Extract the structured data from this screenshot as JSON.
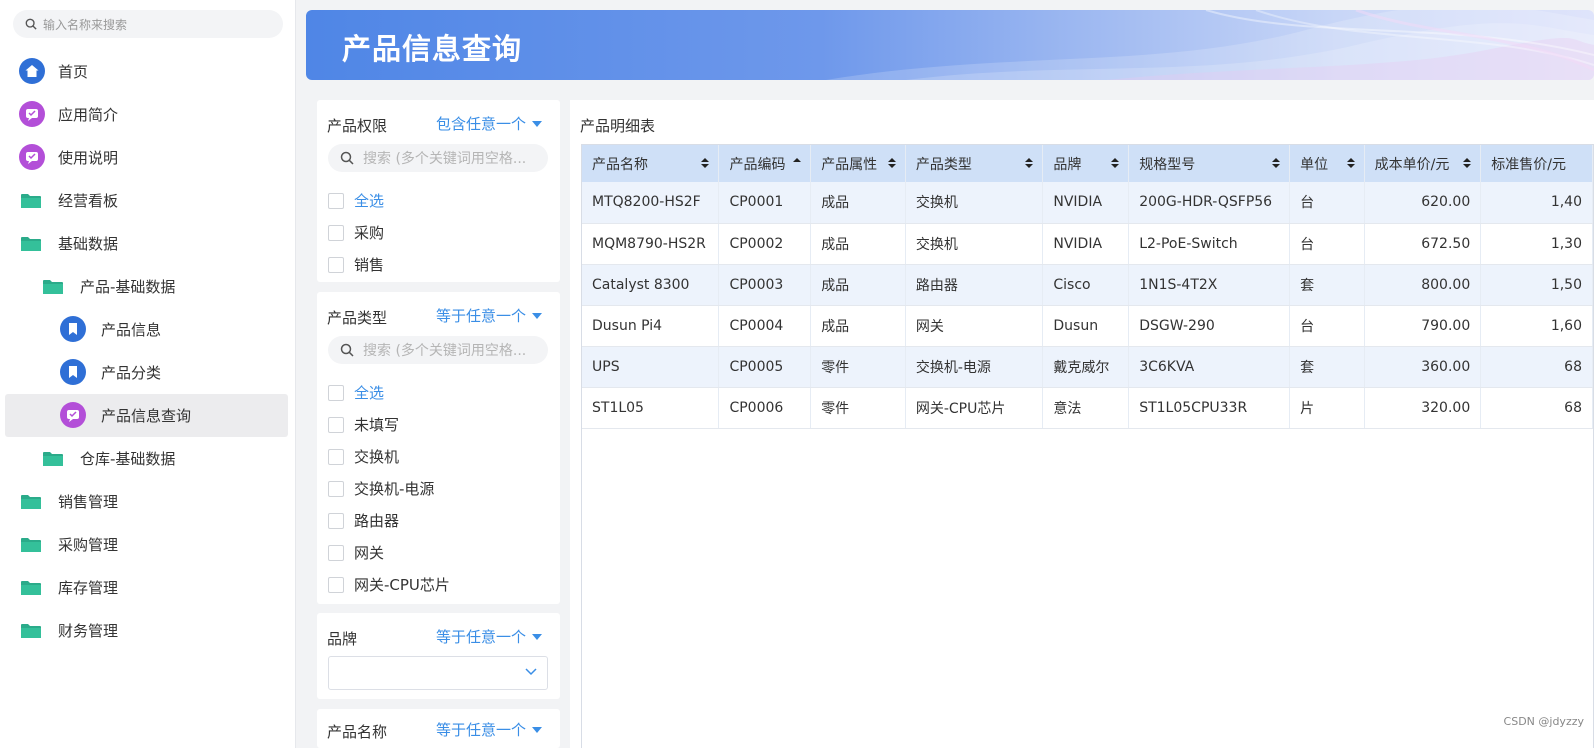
{
  "sidebar": {
    "search_placeholder": "输入名称来搜索",
    "items": [
      {
        "label": "首页",
        "icon": "home-icon"
      },
      {
        "label": "应用简介",
        "icon": "app-icon"
      },
      {
        "label": "使用说明",
        "icon": "app-icon"
      },
      {
        "label": "经营看板",
        "icon": "folder-icon"
      },
      {
        "label": "基础数据",
        "icon": "folder-icon"
      },
      {
        "label": "产品-基础数据",
        "icon": "folder-icon"
      },
      {
        "label": "产品信息",
        "icon": "bookmark-icon"
      },
      {
        "label": "产品分类",
        "icon": "bookmark-icon"
      },
      {
        "label": "产品信息查询",
        "icon": "app-icon"
      },
      {
        "label": "仓库-基础数据",
        "icon": "folder-icon"
      },
      {
        "label": "销售管理",
        "icon": "folder-icon"
      },
      {
        "label": "采购管理",
        "icon": "folder-icon"
      },
      {
        "label": "库存管理",
        "icon": "folder-icon"
      },
      {
        "label": "财务管理",
        "icon": "folder-icon"
      }
    ]
  },
  "header": {
    "title": "产品信息查询"
  },
  "filters": {
    "permission": {
      "label": "产品权限",
      "operator": "包含任意一个",
      "search_placeholder": "搜索 (多个关键词用空格...",
      "options": [
        "全选",
        "采购",
        "销售"
      ]
    },
    "type": {
      "label": "产品类型",
      "operator": "等于任意一个",
      "search_placeholder": "搜索 (多个关键词用空格...",
      "options": [
        "全选",
        "未填写",
        "交换机",
        "交换机-电源",
        "路由器",
        "网关",
        "网关-CPU芯片"
      ]
    },
    "brand": {
      "label": "品牌",
      "operator": "等于任意一个"
    },
    "name": {
      "label": "产品名称",
      "operator": "等于任意一个"
    }
  },
  "table": {
    "title": "产品明细表",
    "columns": [
      "产品名称",
      "产品编码",
      "产品属性",
      "产品类型",
      "品牌",
      "规格型号",
      "单位",
      "成本单价/元",
      "标准售价/元"
    ],
    "rows": [
      [
        "MTQ8200-HS2F",
        "CP0001",
        "成品",
        "交换机",
        "NVIDIA",
        "200G-HDR-QSFP56",
        "台",
        "620.00",
        "1,40"
      ],
      [
        "MQM8790-HS2R",
        "CP0002",
        "成品",
        "交换机",
        "NVIDIA",
        "L2-PoE-Switch",
        "台",
        "672.50",
        "1,30"
      ],
      [
        "Catalyst 8300",
        "CP0003",
        "成品",
        "路由器",
        "Cisco",
        "1N1S-4T2X",
        "套",
        "800.00",
        "1,50"
      ],
      [
        "Dusun Pi4",
        "CP0004",
        "成品",
        "网关",
        "Dusun",
        "DSGW-290",
        "台",
        "790.00",
        "1,60"
      ],
      [
        "UPS",
        "CP0005",
        "零件",
        "交换机-电源",
        "戴克威尔",
        "3C6KVA",
        "套",
        "360.00",
        "68"
      ],
      [
        "ST1L05",
        "CP0006",
        "零件",
        "网关-CPU芯片",
        "意法",
        "ST1L05CPU33R",
        "片",
        "320.00",
        "68"
      ]
    ]
  },
  "watermark": "CSDN @jdyzzy",
  "colors": {
    "accent": "#3a8ee6",
    "header_row": "#cfe0f7",
    "stripe": "#edf3fc",
    "icon_blue": "#2f6fd6",
    "icon_purple": "#b34fd8",
    "folder": "#2bab8a"
  }
}
